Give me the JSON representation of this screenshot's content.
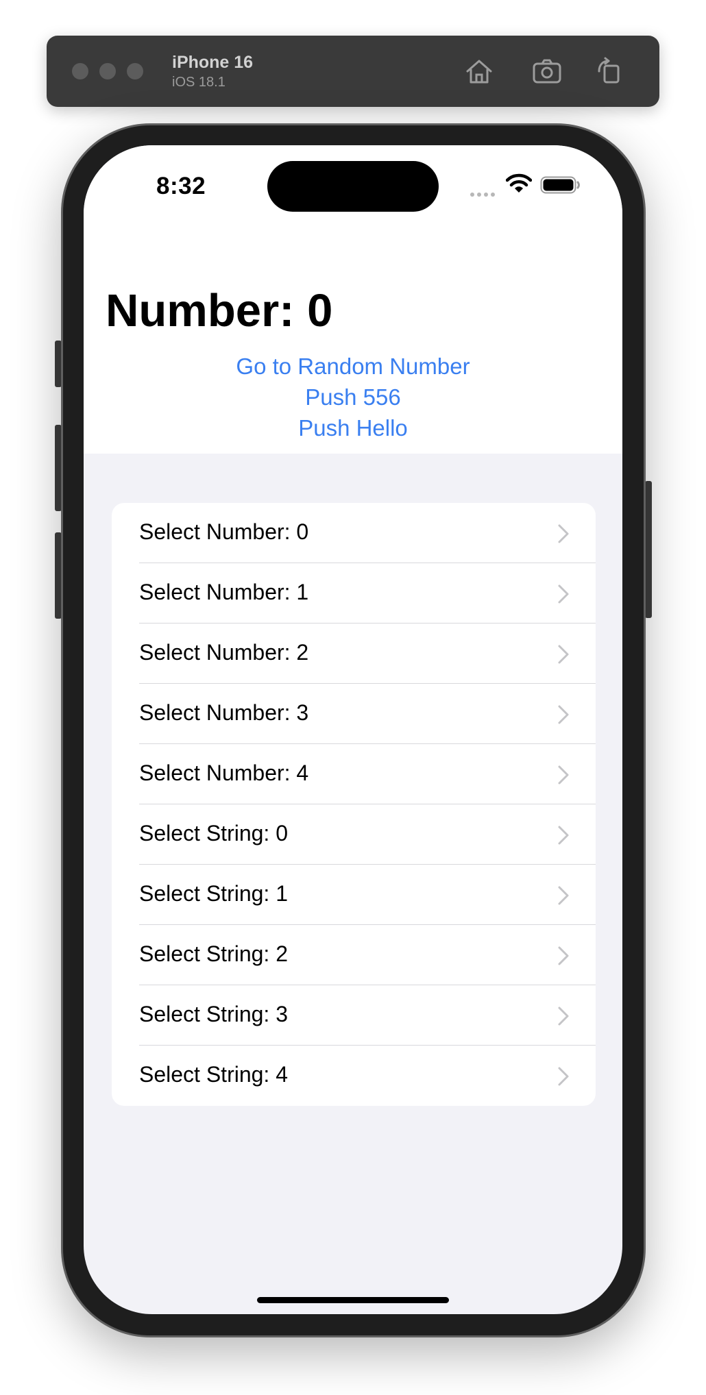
{
  "simulator": {
    "device_name": "iPhone 16",
    "os_version": "iOS 18.1"
  },
  "status_bar": {
    "time": "8:32"
  },
  "nav": {
    "title": "Number: 0",
    "links": [
      "Go to Random Number",
      "Push 556",
      "Push Hello"
    ]
  },
  "list": {
    "rows": [
      "Select Number: 0",
      "Select Number: 1",
      "Select Number: 2",
      "Select Number: 3",
      "Select Number: 4",
      "Select String: 0",
      "Select String: 1",
      "Select String: 2",
      "Select String: 3",
      "Select String: 4"
    ]
  },
  "colors": {
    "accent": "#3a7ff0",
    "background": "#f2f2f7"
  }
}
